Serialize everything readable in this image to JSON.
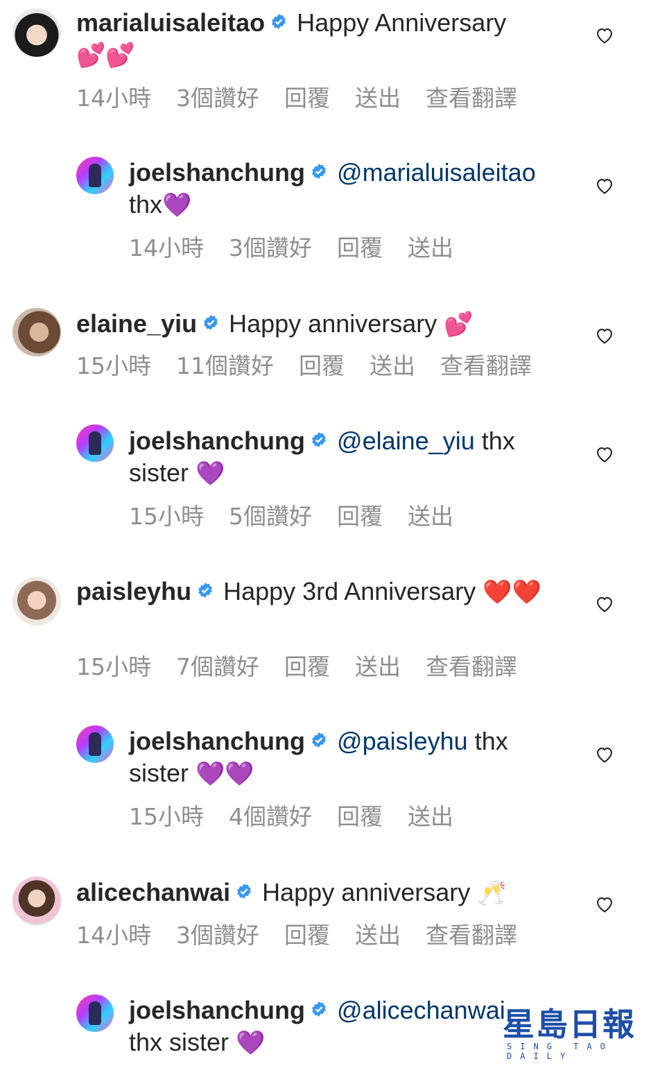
{
  "colors": {
    "mention": "#00376b",
    "meta": "#8e8e8e",
    "verified": "#3897f0",
    "text": "#262626"
  },
  "comments": [
    {
      "username": "marialuisaleitao",
      "text": "Happy Anniversary",
      "emoji": "💕💕",
      "meta": {
        "time": "14小時",
        "likes": "3個讚好",
        "reply": "回覆",
        "send": "送出",
        "translate": "查看翻譯"
      },
      "reply": {
        "username": "joelshanchung",
        "mention": "@marialuisaleitao",
        "text": "thx",
        "emoji": "💜",
        "meta": {
          "time": "14小時",
          "likes": "3個讚好",
          "reply": "回覆",
          "send": "送出"
        }
      }
    },
    {
      "username": "elaine_yiu",
      "text": "Happy anniversary",
      "emoji": "💕",
      "meta": {
        "time": "15小時",
        "likes": "11個讚好",
        "reply": "回覆",
        "send": "送出",
        "translate": "查看翻譯"
      },
      "reply": {
        "username": "joelshanchung",
        "mention": "@elaine_yiu",
        "text": "thx sister",
        "emoji": "💜",
        "meta": {
          "time": "15小時",
          "likes": "5個讚好",
          "reply": "回覆",
          "send": "送出"
        }
      }
    },
    {
      "username": "paisleyhu",
      "text": "Happy 3rd Anniversary",
      "emoji": "❤️❤️",
      "meta": {
        "time": "15小時",
        "likes": "7個讚好",
        "reply": "回覆",
        "send": "送出",
        "translate": "查看翻譯"
      },
      "reply": {
        "username": "joelshanchung",
        "mention": "@paisleyhu",
        "text": "thx sister",
        "emoji": "💜💜",
        "meta": {
          "time": "15小時",
          "likes": "4個讚好",
          "reply": "回覆",
          "send": "送出"
        }
      }
    },
    {
      "username": "alicechanwai",
      "text": "Happy anniversary",
      "emoji": "🥂",
      "meta": {
        "time": "14小時",
        "likes": "3個讚好",
        "reply": "回覆",
        "send": "送出",
        "translate": "查看翻譯"
      },
      "reply": {
        "username": "joelshanchung",
        "mention": "@alicechanwai",
        "text": "thx sister",
        "emoji": "💜"
      }
    }
  ],
  "watermark": {
    "text": "星島日報",
    "sub": "SING TAO DAILY"
  }
}
